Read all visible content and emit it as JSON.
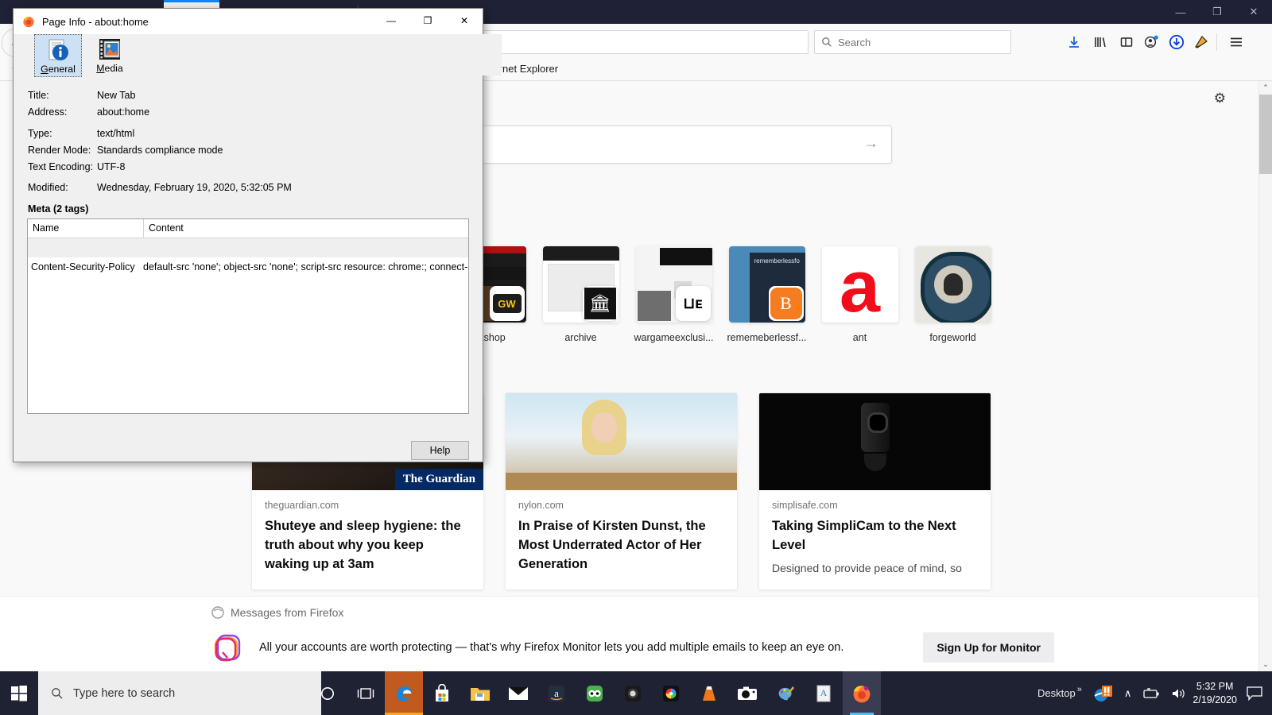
{
  "browser": {
    "window_controls": {
      "minimize": "—",
      "maximize": "❐",
      "close": "✕"
    },
    "back_icon": "←",
    "url_value": "",
    "search": {
      "placeholder": "Search",
      "icon": "search-icon"
    },
    "toolbar_icons": [
      "downloads-icon",
      "library-icon",
      "sidebar-icon",
      "account-icon",
      "update-icon",
      "extension-icon",
      "menu-icon"
    ],
    "bookmarks": [
      {
        "label": "Internet Explorer"
      }
    ]
  },
  "newtab": {
    "gear_icon": "gear-icon",
    "search_placeholder": "",
    "search_arrow": "→",
    "tiles": [
      {
        "label": "orkshop",
        "badge": "gw-logo"
      },
      {
        "label": "archive",
        "badge": "archive-logo"
      },
      {
        "label": "wargameexclusi...",
        "badge": "we-logo"
      },
      {
        "label": "rememeberlessf...",
        "badge": "blogger-logo"
      },
      {
        "label": "ant",
        "badge": "ant-logo"
      },
      {
        "label": "forgeworld",
        "badge": "forgeworld-logo"
      }
    ],
    "cards": [
      {
        "domain": "theguardian.com",
        "title": "Shuteye and sleep hygiene: the truth about why you keep waking up at 3am",
        "excerpt": "",
        "image_label": "The Guardian"
      },
      {
        "domain": "nylon.com",
        "title": "In Praise of Kirsten Dunst, the Most Underrated Actor of Her Generation",
        "excerpt": "",
        "image_label": ""
      },
      {
        "domain": "simplisafe.com",
        "title": "Taking SimpliCam to the Next Level",
        "excerpt": "Designed to provide peace of mind, so",
        "image_label": ""
      }
    ],
    "messages": {
      "heading": "Messages from Firefox",
      "body": "All your accounts are worth protecting — that's why Firefox Monitor lets you add multiple emails to keep an eye on.",
      "button": "Sign Up for Monitor"
    },
    "scrollbar": {
      "up": "⌃",
      "down": "⌄"
    }
  },
  "dialog": {
    "title": "Page Info - about:home",
    "window_controls": {
      "minimize": "—",
      "maximize": "❐",
      "close": "✕"
    },
    "tabs": [
      {
        "label": "General",
        "accel": "G",
        "rest": "eneral",
        "selected": true,
        "icon": "page-info-icon"
      },
      {
        "label": "Media",
        "accel": "M",
        "rest": "edia",
        "selected": false,
        "icon": "media-icon"
      }
    ],
    "fields": [
      {
        "label": "Title:",
        "value": "New Tab"
      },
      {
        "label": "Address:",
        "value": "about:home"
      },
      {
        "label": "Type:",
        "value": "text/html"
      },
      {
        "label": "Render Mode:",
        "value": "Standards compliance mode"
      },
      {
        "label": "Text Encoding:",
        "value": "UTF-8"
      },
      {
        "label": "Modified:",
        "value": "Wednesday, February 19, 2020, 5:32:05 PM"
      }
    ],
    "meta_heading": "Meta (2 tags)",
    "table": {
      "columns": [
        "Name",
        "Content"
      ],
      "rows": [
        {
          "name": "",
          "content": ""
        },
        {
          "name": "Content-Security-Policy",
          "content": "default-src 'none'; object-src 'none'; script-src resource: chrome:; connect-src ..."
        }
      ]
    },
    "help_button": "Help"
  },
  "taskbar": {
    "start_icon": "windows-logo",
    "search_placeholder": "Type here to search",
    "search_icon": "search-icon",
    "items": [
      {
        "name": "cortana-icon",
        "active": false
      },
      {
        "name": "task-view-icon",
        "active": false
      },
      {
        "name": "edge-icon",
        "active": true
      },
      {
        "name": "microsoft-store-icon",
        "active": false
      },
      {
        "name": "file-explorer-icon",
        "active": false
      },
      {
        "name": "mail-icon",
        "active": false
      },
      {
        "name": "amazon-icon",
        "active": false
      },
      {
        "name": "tripadvisor-icon",
        "active": false
      },
      {
        "name": "camera-app-icon",
        "active": false
      },
      {
        "name": "color-app-icon",
        "active": false
      },
      {
        "name": "vlc-icon",
        "active": false
      },
      {
        "name": "camera-icon",
        "active": false
      },
      {
        "name": "paint-icon",
        "active": false
      },
      {
        "name": "reader-icon",
        "active": false
      },
      {
        "name": "firefox-icon",
        "active": true
      }
    ],
    "tray": {
      "desktop_label": "Desktop",
      "overflow": "»",
      "chevron": "∧",
      "time": "5:32 PM",
      "date": "2/19/2020",
      "icons": [
        "ie-notification-icon",
        "battery-icon",
        "volume-icon",
        "action-center-icon"
      ]
    }
  },
  "colors": {
    "firefox_chrome": "#1f2136",
    "accent_blue": "#0a84ff",
    "taskbar": "#1f2233",
    "dialog_bg": "#f0f0f0",
    "tab_selected": "#cde1f5"
  }
}
